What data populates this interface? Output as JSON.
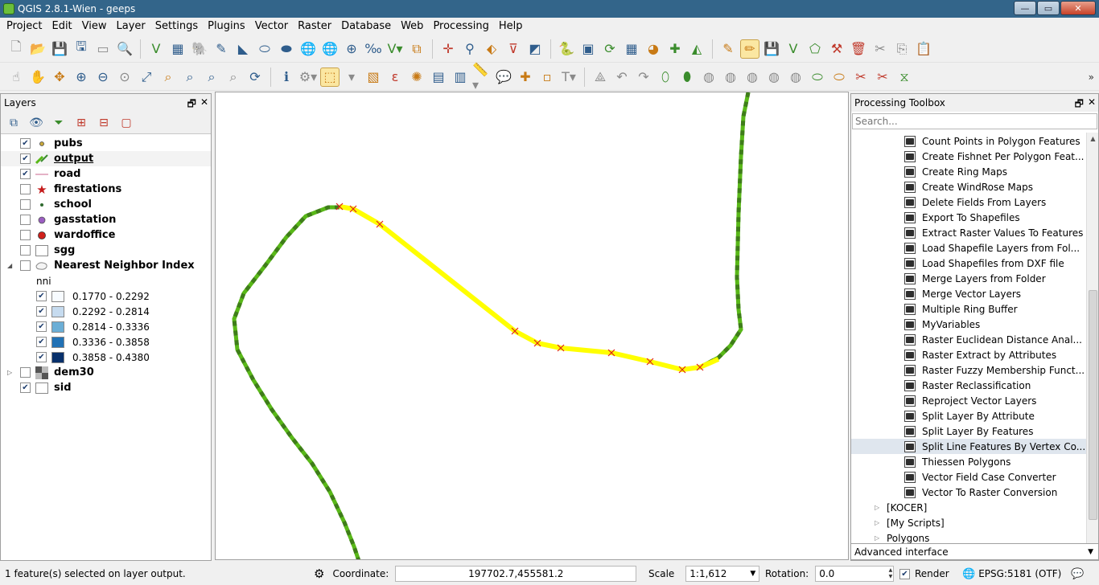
{
  "window": {
    "title": "QGIS 2.8.1-Wien - geeps",
    "buttons": {
      "minimize": "—",
      "maximize": "▭",
      "close": "✕"
    }
  },
  "menu": [
    "Project",
    "Edit",
    "View",
    "Layer",
    "Settings",
    "Plugins",
    "Vector",
    "Raster",
    "Database",
    "Web",
    "Processing",
    "Help"
  ],
  "layers_panel": {
    "title": "Layers",
    "layers": [
      {
        "name": "pubs",
        "checked": true,
        "symbol": "dot-icon"
      },
      {
        "name": "output",
        "checked": true,
        "symbol": "line-edit-icon"
      },
      {
        "name": "road",
        "checked": true,
        "symbol": "line-icon"
      },
      {
        "name": "firestations",
        "checked": false,
        "symbol": "star-icon"
      },
      {
        "name": "school",
        "checked": false,
        "symbol": "dot-icon"
      },
      {
        "name": "gasstation",
        "checked": false,
        "symbol": "purple-circle-icon"
      },
      {
        "name": "wardoffice",
        "checked": false,
        "symbol": "red-circle-icon"
      },
      {
        "name": "sgg",
        "checked": false,
        "symbol": "polygon-icon"
      },
      {
        "name": "Nearest Neighbor Index",
        "checked": false,
        "symbol": "polygon-group-icon"
      }
    ],
    "legend_field": "nni",
    "legend": [
      {
        "label": "0.1770 - 0.2292",
        "color": "#f7fbff"
      },
      {
        "label": "0.2292 - 0.2814",
        "color": "#c6dbef"
      },
      {
        "label": "0.2814 - 0.3336",
        "color": "#6baed6"
      },
      {
        "label": "0.3336 - 0.3858",
        "color": "#2171b5"
      },
      {
        "label": "0.3858 - 0.4380",
        "color": "#08306b"
      }
    ],
    "layers_after": [
      {
        "name": "dem30",
        "checked": false,
        "symbol": "raster-icon"
      },
      {
        "name": "sid",
        "checked": true,
        "symbol": "polygon-icon"
      }
    ]
  },
  "toolbox": {
    "title": "Processing Toolbox",
    "search_placeholder": "Search...",
    "algorithms": [
      "Count Points in Polygon Features",
      "Create Fishnet Per Polygon Feat...",
      "Create Ring Maps",
      "Create WindRose Maps",
      "Delete Fields From Layers",
      "Export To Shapefiles",
      "Extract Raster Values To Features",
      "Load Shapefile Layers from Fol...",
      "Load Shapefiles from DXF file",
      "Merge Layers from Folder",
      "Merge Vector Layers",
      "Multiple Ring Buffer",
      "MyVariables",
      "Raster Euclidean Distance Anal...",
      "Raster Extract by Attributes",
      "Raster Fuzzy Membership Funct...",
      "Raster Reclassification",
      "Reproject Vector Layers",
      "Split Layer By Attribute",
      "Split Layer By Features",
      "Split Line Features By Vertex Co...",
      "Thiessen Polygons",
      "Vector Field Case Converter",
      "Vector To Raster Conversion"
    ],
    "highlighted_index": 20,
    "groups": [
      "[KOCER]",
      "[My Scripts]",
      "Polygons"
    ],
    "mode": "Advanced interface"
  },
  "status": {
    "message": "1 feature(s) selected on layer output.",
    "coordinate_label": "Coordinate:",
    "coordinate_value": "197702.7,455581.2",
    "scale_label": "Scale",
    "scale_value": "1:1,612",
    "rotation_label": "Rotation:",
    "rotation_value": "0.0",
    "render_label": "Render",
    "render_checked": true,
    "crs": "EPSG:5181 (OTF)"
  },
  "colors": {
    "titlebar": "#33658a",
    "road_green": "#59b818",
    "road_dash": "#3f7d1a",
    "selected_yellow": "#ffff00",
    "vertex_red": "#e0201b"
  }
}
